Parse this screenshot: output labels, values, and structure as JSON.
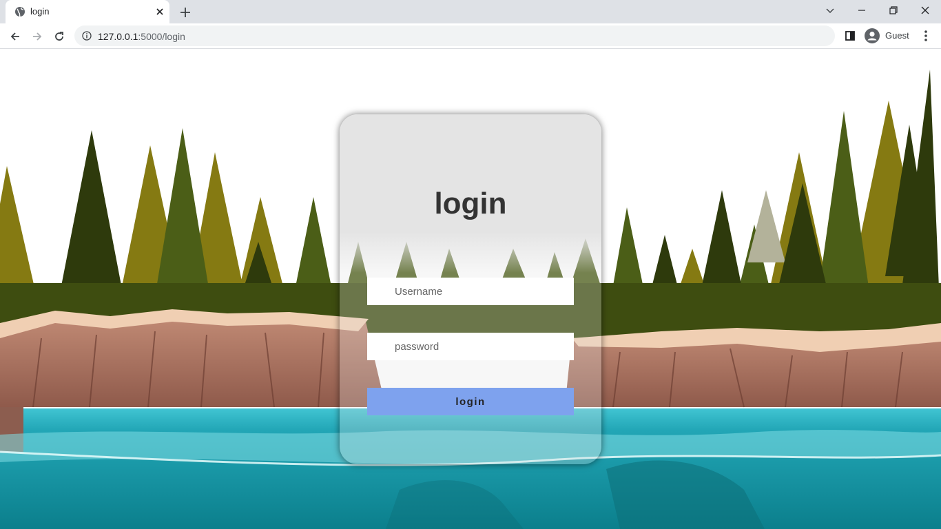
{
  "browser": {
    "tab_title": "login",
    "url_host": "127.0.0.1",
    "url_path": ":5000/login",
    "profile_label": "Guest"
  },
  "login_card": {
    "title": "login",
    "username_placeholder": "Username",
    "password_placeholder": "password",
    "button_label": "login",
    "button_color": "#7ea2ee"
  },
  "icons": {
    "tab_favicon": "globe-icon",
    "tab_close": "close-icon",
    "new_tab": "plus-icon",
    "back": "arrow-left-icon",
    "forward": "arrow-right-icon",
    "reload": "reload-icon",
    "site_info": "info-icon",
    "side_panel": "side-panel-icon",
    "profile": "avatar-icon",
    "menu": "kebab-menu-icon"
  },
  "colors": {
    "sky": "#ffffff",
    "tree_olive": "#7b7210",
    "tree_dark": "#2f3a10",
    "cliff": "#b07a66",
    "sand": "#f1d1b6",
    "water": "#1d9cac"
  }
}
